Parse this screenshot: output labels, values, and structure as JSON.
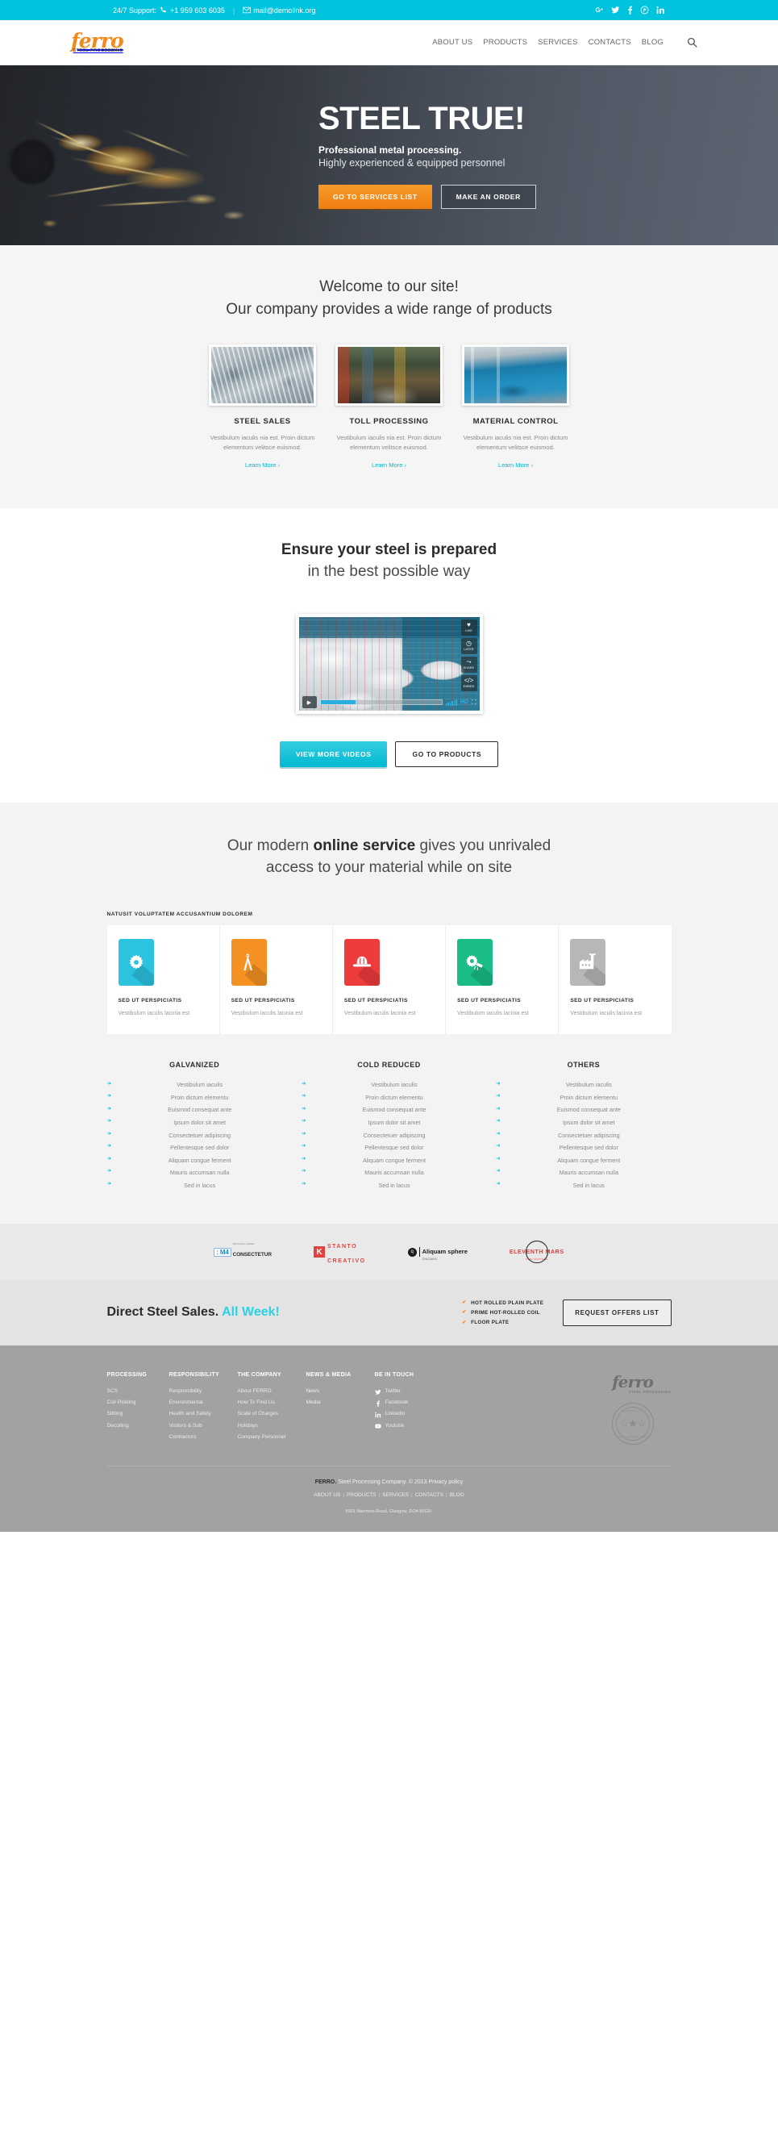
{
  "topbar": {
    "support_label": "24/7 Support:",
    "phone": "+1 959 603 6035",
    "email": "mail@demolink.org",
    "social": [
      {
        "name": "googleplus",
        "glyph": "g⁺"
      },
      {
        "name": "twitter",
        "glyph": "🐦"
      },
      {
        "name": "facebook",
        "glyph": "f"
      },
      {
        "name": "pinterest",
        "glyph": "℗"
      },
      {
        "name": "linkedin",
        "glyph": "in"
      }
    ]
  },
  "header": {
    "logo_main": "ferro",
    "logo_sub": "STEEL PROCESSING",
    "nav": [
      "ABOUT US",
      "PRODUCTS",
      "SERVICES",
      "CONTACTS",
      "BLOG"
    ],
    "search_icon": "search-icon"
  },
  "hero": {
    "title": "STEEL TRUE!",
    "subtitle_bold": "Professional metal processing.",
    "subtitle_light": "Highly experienced & equipped personnel",
    "btn_primary": "GO TO SERVICES LIST",
    "btn_secondary": "MAKE AN ORDER"
  },
  "welcome": {
    "line1": "Welcome to our site!",
    "line2": "Our company provides a wide range of products",
    "cards": [
      {
        "title": "STEEL SALES",
        "text": "Vestibulum iaculis nia est. Proin dictum elementum velitsce euismod.",
        "link": "Learn More ›"
      },
      {
        "title": "TOLL PROCESSING",
        "text": "Vestibulum iaculis nia est. Proin dictum elementum velitsce euismod.",
        "link": "Learn More ›"
      },
      {
        "title": "MATERIAL CONTROL",
        "text": "Vestibulum iaculis nia est. Proin dictum elementum velitsce euismod.",
        "link": "Learn More ›"
      }
    ]
  },
  "video": {
    "heading_bold": "Ensure your steel is prepared",
    "heading_light": "in the best possible way",
    "side_buttons": [
      {
        "label": "LIKE",
        "icon": "heart-icon"
      },
      {
        "label": "LATER",
        "icon": "clock-icon"
      },
      {
        "label": "SHARE",
        "icon": "share-icon"
      },
      {
        "label": "EMBED",
        "icon": "code-icon"
      }
    ],
    "hd_label": "HD",
    "btn_primary": "VIEW MORE VIDEOS",
    "btn_secondary": "GO TO PRODUCTS"
  },
  "online": {
    "heading_pre": "Our modern ",
    "heading_bold": "online service",
    "heading_post": " gives you unrivaled",
    "heading_line2": "access to your material while on site",
    "eyebrow": "NATUSIT VOLUPTATEM ACCUSANTIUM DOLOREM",
    "boxes": [
      {
        "title": "SED UT PERSPICIATIS",
        "text": "Vestibulum iaculis lacinia est",
        "color": "#2cc3e0",
        "icon": "gear-icon"
      },
      {
        "title": "SED UT PERSPICIATIS",
        "text": "Vestibulum iaculis lacinia est",
        "color": "#f49122",
        "icon": "pliers-icon"
      },
      {
        "title": "SED UT PERSPICIATIS",
        "text": "Vestibulum iaculis lacinia est",
        "color": "#ee3b3b",
        "icon": "helmet-icon"
      },
      {
        "title": "SED UT PERSPICIATIS",
        "text": "Vestibulum iaculis lacinia est",
        "color": "#1abc87",
        "icon": "grinder-icon"
      },
      {
        "title": "SED UT PERSPICIATIS",
        "text": "Vestibulum iaculis lacinia est",
        "color": "#b7b7b7",
        "icon": "factory-icon"
      }
    ]
  },
  "lists": [
    {
      "title": "GALVANIZED",
      "items": [
        "Vestibulum iaculis",
        "Proin dictum elementu",
        "Euismod consequat ante",
        "Ipsum dolor sit amet",
        "Consectetuer adipiscing",
        "Pellentesque sed dolor",
        "Aliquam congue ferment",
        "Mauris accumsan nulla",
        "Sed in lacus"
      ]
    },
    {
      "title": "COLD REDUCED",
      "items": [
        "Vestibulum iaculis",
        "Proin dictum elementu",
        "Euismod consequat ante",
        "Ipsum dolor sit amet",
        "Consectetuer adipiscing",
        "Pellentesque sed dolor",
        "Aliquam congue ferment",
        "Mauris accumsan nulla",
        "Sed in lacus"
      ]
    },
    {
      "title": "OTHERS",
      "items": [
        "Vestibulum iaculis",
        "Proin dictum elementu",
        "Euismod consequat ante",
        "Ipsum dolor sit amet",
        "Consectetuer adipiscing",
        "Pellentesque sed dolor",
        "Aliquam congue ferment",
        "Mauris accumsan nulla",
        "Sed in lacus"
      ]
    }
  ],
  "partners": [
    {
      "name": "m4-consectetur",
      "mark": ": M4",
      "tiny": "INDUSTRIAL THEMES",
      "text": "CONSECTETUR"
    },
    {
      "name": "stanto-creativo",
      "mark": "K",
      "text_line1": "STANTO",
      "text_line2": "CREATIVO"
    },
    {
      "name": "aliquam-sphere",
      "mark": "q",
      "text_line1": "Aliquam sphere",
      "tiny": "CHICAGO"
    },
    {
      "name": "eleventh-mars",
      "text": "ELEVENTH MARS",
      "tiny": "TIME MATTERS"
    }
  ],
  "cta": {
    "title_plain": "Direct Steel Sales.",
    "title_highlight": "All Week!",
    "checks": [
      "HOT ROLLED PLAIN PLATE",
      "PRIME HOT-ROLLED COIL",
      "FLOOR PLATE"
    ],
    "button": "REQUEST OFFERS LIST"
  },
  "footer": {
    "columns": [
      {
        "title": "PROCESSING",
        "links": [
          "SCS",
          "Coil Pickling",
          "Slitting",
          "Decoiling"
        ]
      },
      {
        "title": "RESPONSIBILITY",
        "links": [
          "Responsibility",
          "Environmental",
          "Health and Safety",
          "Visitors & Sub",
          "Contractors"
        ]
      },
      {
        "title": "THE COMPANY",
        "links": [
          "About FERRO",
          "How To Find Us",
          "Scale of Charges",
          "Holidays",
          "Company Personnel"
        ]
      },
      {
        "title": "NEWS & MEDIA",
        "links": [
          "News",
          "Media"
        ]
      }
    ],
    "social_title": "BE IN TOUCH",
    "social": [
      {
        "label": "Twitter",
        "icon": "twitter-icon"
      },
      {
        "label": "Facebook",
        "icon": "facebook-icon"
      },
      {
        "label": "LinkedIn",
        "icon": "linkedin-icon"
      },
      {
        "label": "Youtube",
        "icon": "youtube-icon"
      }
    ],
    "logo_main": "ferro",
    "logo_sub": "STEEL PROCESSING",
    "seal_top": "BEST QUALITY",
    "seal_bottom": "BEST QUALITY 1920",
    "copyright_brand": "FERRO.",
    "copyright_rest": " Steel Processing Company. © 2013 Privacy policy",
    "bottom_nav": [
      "ABOUT US",
      "PRODUCTS",
      "SERVICES",
      "CONTACTS",
      "BLOG"
    ],
    "address": "8901 Marmora Road, Glasgow, DO4 89GR."
  }
}
